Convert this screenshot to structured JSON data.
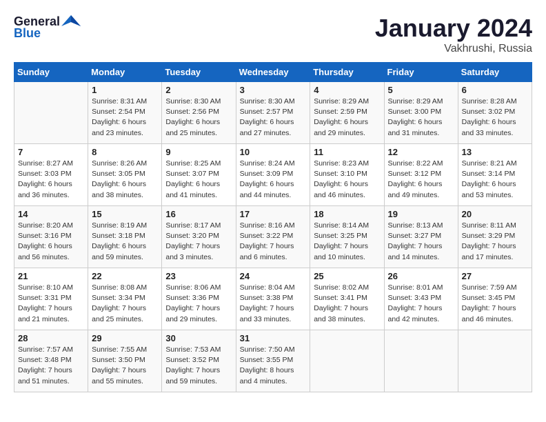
{
  "header": {
    "logo_general": "General",
    "logo_blue": "Blue",
    "title": "January 2024",
    "subtitle": "Vakhrushi, Russia"
  },
  "days_of_week": [
    "Sunday",
    "Monday",
    "Tuesday",
    "Wednesday",
    "Thursday",
    "Friday",
    "Saturday"
  ],
  "weeks": [
    [
      {
        "day": "",
        "info": ""
      },
      {
        "day": "1",
        "info": "Sunrise: 8:31 AM\nSunset: 2:54 PM\nDaylight: 6 hours\nand 23 minutes."
      },
      {
        "day": "2",
        "info": "Sunrise: 8:30 AM\nSunset: 2:56 PM\nDaylight: 6 hours\nand 25 minutes."
      },
      {
        "day": "3",
        "info": "Sunrise: 8:30 AM\nSunset: 2:57 PM\nDaylight: 6 hours\nand 27 minutes."
      },
      {
        "day": "4",
        "info": "Sunrise: 8:29 AM\nSunset: 2:59 PM\nDaylight: 6 hours\nand 29 minutes."
      },
      {
        "day": "5",
        "info": "Sunrise: 8:29 AM\nSunset: 3:00 PM\nDaylight: 6 hours\nand 31 minutes."
      },
      {
        "day": "6",
        "info": "Sunrise: 8:28 AM\nSunset: 3:02 PM\nDaylight: 6 hours\nand 33 minutes."
      }
    ],
    [
      {
        "day": "7",
        "info": "Sunrise: 8:27 AM\nSunset: 3:03 PM\nDaylight: 6 hours\nand 36 minutes."
      },
      {
        "day": "8",
        "info": "Sunrise: 8:26 AM\nSunset: 3:05 PM\nDaylight: 6 hours\nand 38 minutes."
      },
      {
        "day": "9",
        "info": "Sunrise: 8:25 AM\nSunset: 3:07 PM\nDaylight: 6 hours\nand 41 minutes."
      },
      {
        "day": "10",
        "info": "Sunrise: 8:24 AM\nSunset: 3:09 PM\nDaylight: 6 hours\nand 44 minutes."
      },
      {
        "day": "11",
        "info": "Sunrise: 8:23 AM\nSunset: 3:10 PM\nDaylight: 6 hours\nand 46 minutes."
      },
      {
        "day": "12",
        "info": "Sunrise: 8:22 AM\nSunset: 3:12 PM\nDaylight: 6 hours\nand 49 minutes."
      },
      {
        "day": "13",
        "info": "Sunrise: 8:21 AM\nSunset: 3:14 PM\nDaylight: 6 hours\nand 53 minutes."
      }
    ],
    [
      {
        "day": "14",
        "info": "Sunrise: 8:20 AM\nSunset: 3:16 PM\nDaylight: 6 hours\nand 56 minutes."
      },
      {
        "day": "15",
        "info": "Sunrise: 8:19 AM\nSunset: 3:18 PM\nDaylight: 6 hours\nand 59 minutes."
      },
      {
        "day": "16",
        "info": "Sunrise: 8:17 AM\nSunset: 3:20 PM\nDaylight: 7 hours\nand 3 minutes."
      },
      {
        "day": "17",
        "info": "Sunrise: 8:16 AM\nSunset: 3:22 PM\nDaylight: 7 hours\nand 6 minutes."
      },
      {
        "day": "18",
        "info": "Sunrise: 8:14 AM\nSunset: 3:25 PM\nDaylight: 7 hours\nand 10 minutes."
      },
      {
        "day": "19",
        "info": "Sunrise: 8:13 AM\nSunset: 3:27 PM\nDaylight: 7 hours\nand 14 minutes."
      },
      {
        "day": "20",
        "info": "Sunrise: 8:11 AM\nSunset: 3:29 PM\nDaylight: 7 hours\nand 17 minutes."
      }
    ],
    [
      {
        "day": "21",
        "info": "Sunrise: 8:10 AM\nSunset: 3:31 PM\nDaylight: 7 hours\nand 21 minutes."
      },
      {
        "day": "22",
        "info": "Sunrise: 8:08 AM\nSunset: 3:34 PM\nDaylight: 7 hours\nand 25 minutes."
      },
      {
        "day": "23",
        "info": "Sunrise: 8:06 AM\nSunset: 3:36 PM\nDaylight: 7 hours\nand 29 minutes."
      },
      {
        "day": "24",
        "info": "Sunrise: 8:04 AM\nSunset: 3:38 PM\nDaylight: 7 hours\nand 33 minutes."
      },
      {
        "day": "25",
        "info": "Sunrise: 8:02 AM\nSunset: 3:41 PM\nDaylight: 7 hours\nand 38 minutes."
      },
      {
        "day": "26",
        "info": "Sunrise: 8:01 AM\nSunset: 3:43 PM\nDaylight: 7 hours\nand 42 minutes."
      },
      {
        "day": "27",
        "info": "Sunrise: 7:59 AM\nSunset: 3:45 PM\nDaylight: 7 hours\nand 46 minutes."
      }
    ],
    [
      {
        "day": "28",
        "info": "Sunrise: 7:57 AM\nSunset: 3:48 PM\nDaylight: 7 hours\nand 51 minutes."
      },
      {
        "day": "29",
        "info": "Sunrise: 7:55 AM\nSunset: 3:50 PM\nDaylight: 7 hours\nand 55 minutes."
      },
      {
        "day": "30",
        "info": "Sunrise: 7:53 AM\nSunset: 3:52 PM\nDaylight: 7 hours\nand 59 minutes."
      },
      {
        "day": "31",
        "info": "Sunrise: 7:50 AM\nSunset: 3:55 PM\nDaylight: 8 hours\nand 4 minutes."
      },
      {
        "day": "",
        "info": ""
      },
      {
        "day": "",
        "info": ""
      },
      {
        "day": "",
        "info": ""
      }
    ]
  ]
}
